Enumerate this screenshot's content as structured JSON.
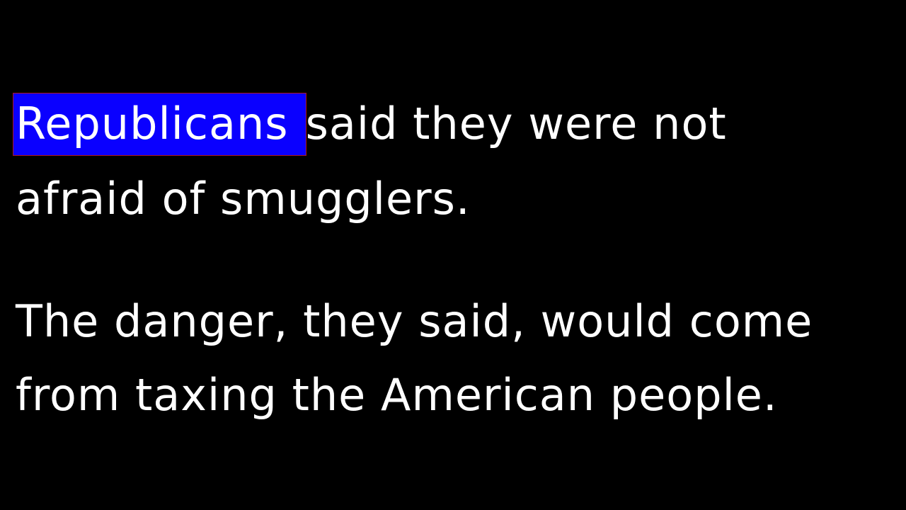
{
  "highlight_color": "#0a00ff",
  "text_color": "#ffffff",
  "background_color": "#000000",
  "paragraph1": {
    "highlighted_word": "Republicans",
    "line1_rest": "said they were not",
    "line2": "afraid of smugglers."
  },
  "paragraph2": {
    "line1": "The danger, they said, would come",
    "line2": "from taxing the American people."
  }
}
